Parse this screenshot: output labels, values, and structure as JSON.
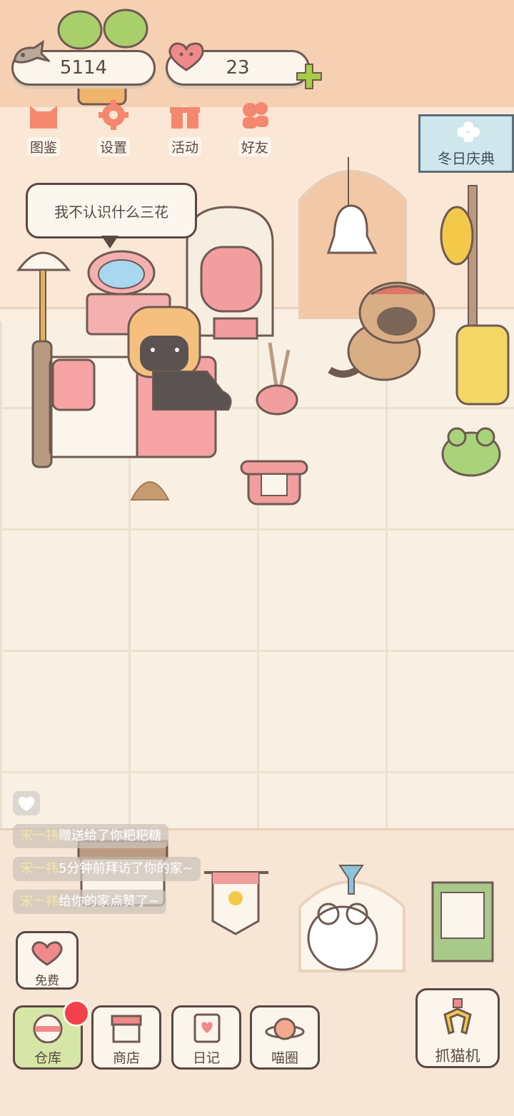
{
  "resources": {
    "fish": "5114",
    "hearts": "23"
  },
  "menu": [
    {
      "label": "图鉴",
      "icon": "cat-book-icon"
    },
    {
      "label": "设置",
      "icon": "gear-icon"
    },
    {
      "label": "活动",
      "icon": "gift-icon"
    },
    {
      "label": "好友",
      "icon": "friends-icon"
    }
  ],
  "event_banner": {
    "label": "冬日庆典",
    "icon": "snowflake-flower-icon"
  },
  "speech_bubble": "我不认识什么三花",
  "chat_feed": [
    {
      "name": "宋一祎",
      "text": "赠送给了你粑粑糖"
    },
    {
      "name": "宋一祎",
      "text": "5分钟前拜访了你的家~"
    },
    {
      "name": "宋一祎",
      "text": "给你的家点赞了~"
    }
  ],
  "free_button": {
    "label": "免费"
  },
  "bottom_nav": [
    {
      "label": "仓库",
      "icon": "warehouse-icon"
    },
    {
      "label": "商店",
      "icon": "shop-icon"
    },
    {
      "label": "日记",
      "icon": "diary-icon"
    },
    {
      "label": "喵圈",
      "icon": "planet-cat-icon"
    }
  ],
  "claw_button": {
    "label": "抓猫机"
  },
  "colors": {
    "outline": "#5a4843",
    "accent_green": "#a6cc46",
    "notification": "#f2404a",
    "wall": "#fbe7d6",
    "floor": "#f8f0e2"
  }
}
